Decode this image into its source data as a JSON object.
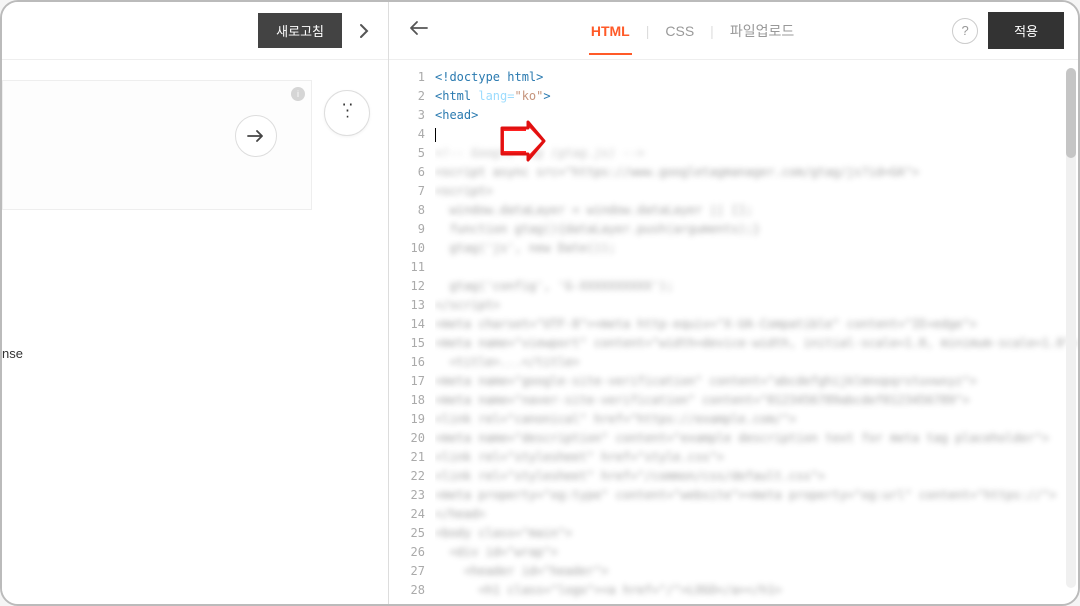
{
  "leftHeader": {
    "refresh": "새로고침"
  },
  "leftBody": {
    "bottomText": "nse"
  },
  "rightHeader": {
    "tabs": {
      "html": "HTML",
      "css": "CSS",
      "upload": "파일업로드"
    },
    "help": "?",
    "apply": "적용"
  },
  "code": {
    "lineNumbers": [
      "1",
      "2",
      "3",
      "4",
      "5",
      "6",
      "7",
      "8",
      "9",
      "10",
      "11",
      "12",
      "13",
      "14",
      "15",
      "16",
      "17",
      "18",
      "19",
      "20",
      "21",
      "22",
      "23",
      "24",
      "25",
      "26",
      "27",
      "28"
    ],
    "lines": {
      "l1_open": "<!doctype html>",
      "l2": "<html lang=\"ko\">",
      "l3": "<head>",
      "l4": "",
      "l5": "<!-- Google tag (gtag.js) -->",
      "blurred": [
        "<script async src=\"https://www.googletagmanager.com/gtag/js?id=GA\">",
        "<script>",
        "  window.dataLayer = window.dataLayer || [];",
        "  function gtag(){dataLayer.push(arguments);}",
        "  gtag('js', new Date());",
        "",
        "  gtag('config', 'G-XXXXXXXXXX');",
        "</script>",
        "<meta charset=\"UTF-8\"><meta http-equiv=\"X-UA-Compatible\" content=\"IE=edge\">",
        "<meta name=\"viewport\" content=\"width=device-width, initial-scale=1.0, minimum-scale=1.0\">",
        "  <title>...</title>",
        "<meta name=\"google-site-verification\" content=\"abcdefghijklmnopqrstuvwxyz\">",
        "<meta name=\"naver-site-verification\" content=\"0123456789abcdef0123456789\">",
        "<link rel=\"canonical\" href=\"https://example.com/\">",
        "<meta name=\"description\" content=\"example description text for meta tag placeholder\">",
        "<link rel=\"stylesheet\" href=\"style.css\">",
        "<link rel=\"stylesheet\" href=\"/common/css/default.css\">",
        "<meta property=\"og:type\" content=\"website\"><meta property=\"og:url\" content=\"https://\">",
        "</head>",
        "<body class=\"main\">",
        "  <div id=\"wrap\">",
        "    <header id=\"header\">",
        "      <h1 class=\"logo\"><a href=\"/\">LOGO</a></h1>"
      ]
    }
  }
}
